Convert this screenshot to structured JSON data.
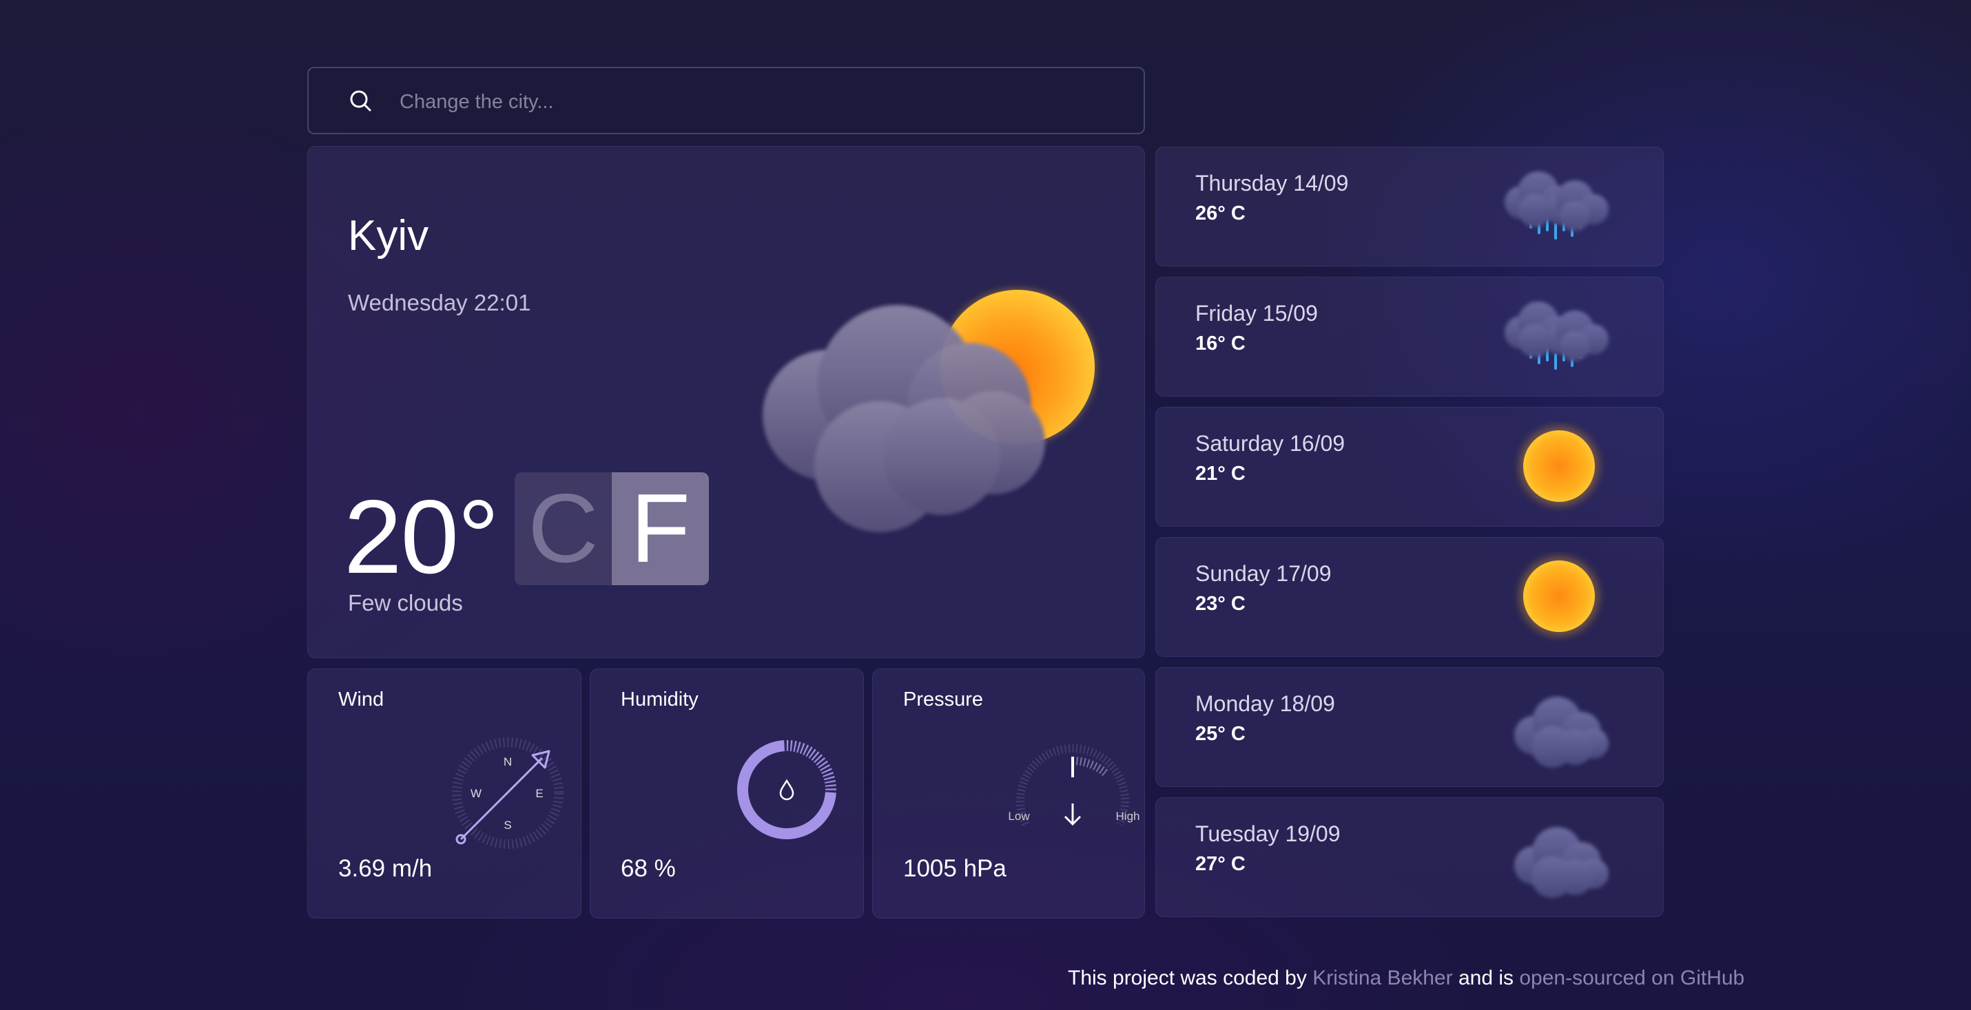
{
  "search": {
    "placeholder": "Change the city...",
    "icon": "search-icon"
  },
  "current": {
    "city": "Kyiv",
    "datetime": "Wednesday 22:01",
    "temperature": "20°",
    "condition": "Few clouds",
    "icon": "cloud-sun-icon",
    "units": {
      "celsius": "C",
      "fahrenheit": "F",
      "selected": "F"
    }
  },
  "stats": {
    "wind": {
      "title": "Wind",
      "value": "3.69 m/h",
      "compass": {
        "n": "N",
        "e": "E",
        "s": "S",
        "w": "W"
      }
    },
    "humidity": {
      "title": "Humidity",
      "value": "68 %",
      "fraction": 0.68
    },
    "pressure": {
      "title": "Pressure",
      "value": "1005 hPa",
      "low_label": "Low",
      "high_label": "High"
    }
  },
  "forecast": [
    {
      "day": "Thursday",
      "date": "14/09",
      "temp": "26° C",
      "icon": "rain-clouds-icon"
    },
    {
      "day": "Friday",
      "date": "15/09",
      "temp": "16° C",
      "icon": "rain-clouds-icon"
    },
    {
      "day": "Saturday",
      "date": "16/09",
      "temp": "21° C",
      "icon": "sun-icon"
    },
    {
      "day": "Sunday",
      "date": "17/09",
      "temp": "23° C",
      "icon": "sun-icon"
    },
    {
      "day": "Monday",
      "date": "18/09",
      "temp": "25° C",
      "icon": "cloud-icon"
    },
    {
      "day": "Tuesday",
      "date": "19/09",
      "temp": "27° C",
      "icon": "cloud-icon"
    }
  ],
  "footer": {
    "prefix": "This project was coded by",
    "author": "Kristina Bekher",
    "middle": "and is",
    "link": "open-sourced on GitHub"
  },
  "colors": {
    "accent": "#9b87e0",
    "sun": "#ffb21a",
    "rain": "#3ab0f0"
  }
}
